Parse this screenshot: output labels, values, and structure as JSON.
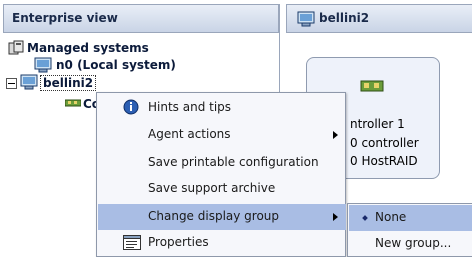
{
  "left_pane": {
    "header": "Enterprise view"
  },
  "tree": {
    "root": "Managed systems",
    "n0": "n0 (Local system)",
    "bellini": "bellini2",
    "controller_partial": "Co"
  },
  "right_pane": {
    "header": "bellini2",
    "card_lines": [
      "ntroller 1",
      "0 controller",
      "0 HostRAID"
    ]
  },
  "context_menu": {
    "items": [
      {
        "label": "Hints and tips",
        "icon": "info-icon"
      },
      {
        "label": "Agent actions",
        "submenu": true
      },
      {
        "label": "Save printable configuration"
      },
      {
        "label": "Save support archive"
      },
      {
        "label": "Change display group",
        "submenu": true,
        "highlighted": true
      },
      {
        "label": "Properties",
        "icon": "properties-icon"
      }
    ]
  },
  "submenu": {
    "items": [
      {
        "label": "None",
        "selected": true
      },
      {
        "label": "New group..."
      }
    ]
  },
  "colors": {
    "highlight": "#a9bde4",
    "header_bg": "#c9d4e6",
    "menu_bg": "#f6f7fb"
  }
}
